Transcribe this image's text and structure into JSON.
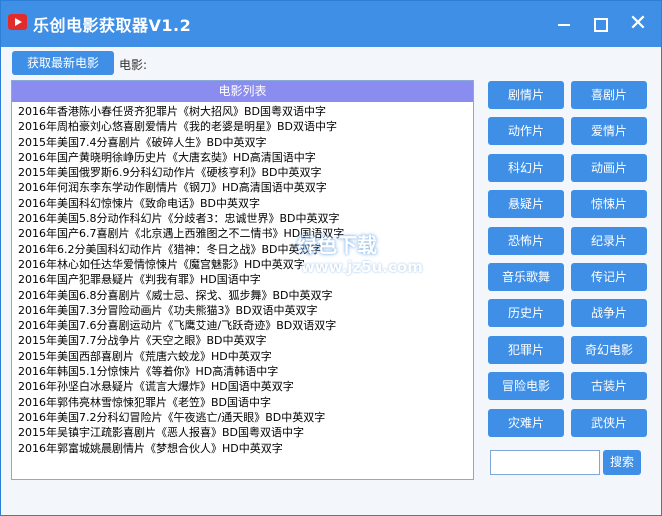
{
  "app": {
    "title": "乐创电影获取器V1.2"
  },
  "toolbar": {
    "fetch_label": "获取最新电影",
    "movie_label": "电影:"
  },
  "list": {
    "header": "电影列表",
    "items": [
      "2016年香港陈小春任贤齐犯罪片《树大招风》BD国粤双语中字",
      "2016年周柏豪刘心悠喜剧爱情片《我的老婆是明星》BD双语中字",
      "2015年美国7.4分喜剧片《破碎人生》BD中英双字",
      "2016年国产黄晓明徐峥历史片《大唐玄奘》HD高清国语中字",
      "2015年美国俄罗斯6.9分科幻动作片《硬核亨利》BD中英双字",
      "2016年何润东李东学动作剧情片《钢刀》HD高清国语中英双字",
      "2016年美国科幻惊悚片《致命电话》BD中英双字",
      "2016年美国5.8分动作科幻片《分歧者3：忠诚世界》BD中英双字",
      "2016年国产6.7喜剧片《北京遇上西雅图之不二情书》HD国语双字",
      "2016年6.2分美国科幻动作片《猎神：冬日之战》BD中英双字",
      "2016年林心如任达华爱情惊悚片《魔宫魅影》HD中英双字",
      "2016年国产犯罪悬疑片《判我有罪》HD国语中字",
      "2016年美国6.8分喜剧片《威士忌、探戈、狐步舞》BD中英双字",
      "2016年美国7.3分冒险动画片《功夫熊猫3》BD双语中英双字",
      "2016年美国7.6分喜剧运动片《飞鹰艾迪/飞跃奇迹》BD双语双字",
      "2015年美国7.7分战争片《天空之眼》BD中英双字",
      "2015年美国西部喜剧片《荒唐六蛟龙》HD中英双字",
      "2016年韩国5.1分惊悚片《等着你》HD高清韩语中字",
      "2016年孙坚白冰悬疑片《谎言大爆炸》HD国语中英双字",
      "2016年郭伟亮林雪惊悚犯罪片《老笠》BD国语中字",
      "2016年美国7.2分科幻冒险片《午夜逃亡/通天眼》BD中英双字",
      "2015年吴镇宇江疏影喜剧片《恶人报喜》BD国粤双语中字",
      "2016年郭富城姚晨剧情片《梦想合伙人》HD中英双字"
    ]
  },
  "categories": [
    "剧情片",
    "喜剧片",
    "动作片",
    "爱情片",
    "科幻片",
    "动画片",
    "悬疑片",
    "惊悚片",
    "恐怖片",
    "纪录片",
    "音乐歌舞",
    "传记片",
    "历史片",
    "战争片",
    "犯罪片",
    "奇幻电影",
    "冒险电影",
    "古装片",
    "灾难片",
    "武侠片"
  ],
  "search": {
    "placeholder": "",
    "button_label": "搜索"
  },
  "watermark": {
    "text": "绿色下载",
    "url": "www.jz5u.com"
  },
  "colors": {
    "titlebar": "#3f8fe6",
    "button": "#3f8fe6",
    "list_header": "#8a8cf0",
    "close_icon_bg": "#e42b2b"
  },
  "icons": {
    "app": "app-logo-icon",
    "minimize": "minimize-icon",
    "maximize": "maximize-icon",
    "close": "close-icon"
  }
}
